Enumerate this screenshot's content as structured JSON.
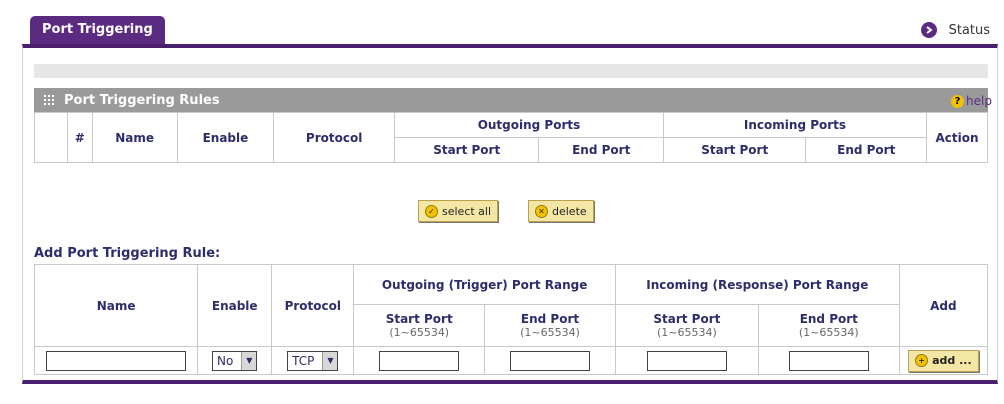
{
  "tab_label": "Port Triggering",
  "status_label": "Status",
  "rules": {
    "title": "Port Triggering Rules",
    "help_label": "help",
    "headers": {
      "num": "#",
      "name": "Name",
      "enable": "Enable",
      "protocol": "Protocol",
      "outgoing": "Outgoing Ports",
      "incoming": "Incoming Ports",
      "action": "Action",
      "start_port": "Start Port",
      "end_port": "End Port"
    }
  },
  "buttons": {
    "select_all": "select all",
    "delete": "delete",
    "add": "add ..."
  },
  "add_rule": {
    "title": "Add Port Triggering Rule:",
    "headers": {
      "name": "Name",
      "enable": "Enable",
      "protocol": "Protocol",
      "outgoing": "Outgoing (Trigger) Port Range",
      "incoming": "Incoming (Response) Port Range",
      "add": "Add",
      "start_port": "Start Port",
      "end_port": "End Port",
      "range": "(1~65534)"
    },
    "enable_value": "No",
    "protocol_value": "TCP"
  }
}
